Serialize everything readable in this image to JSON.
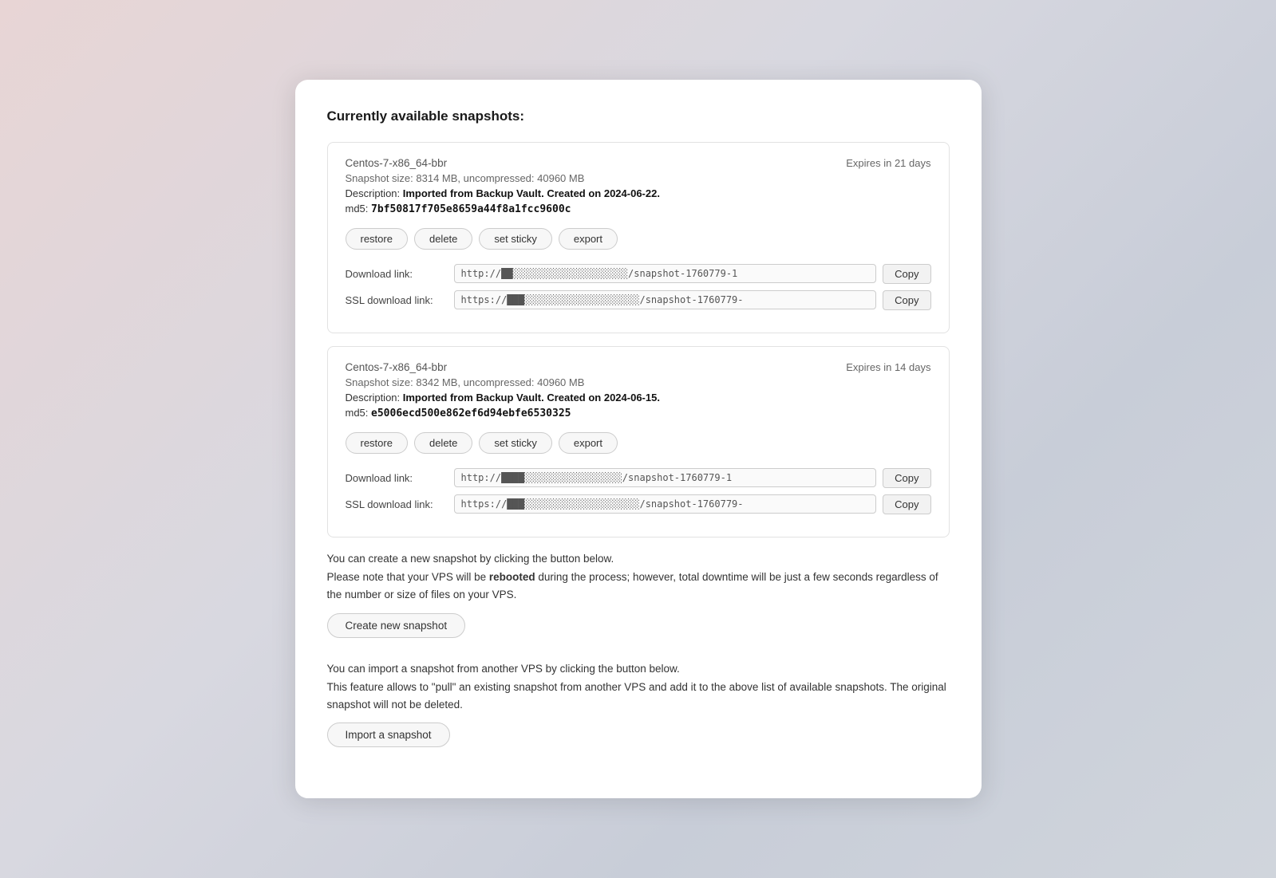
{
  "page": {
    "title": "Currently available snapshots:"
  },
  "snapshots": [
    {
      "id": "snap1",
      "name": "Centos-7-x86_64-bbr",
      "expires": "Expires in 21 days",
      "size": "Snapshot size: 8314 MB, uncompressed: 40960 MB",
      "description_prefix": "Description: ",
      "description_bold": "Imported from Backup Vault. Created on 2024-06-22.",
      "md5_prefix": "md5: ",
      "md5": "7bf50817f705e8659a44f8a1fcc9600c",
      "actions": [
        "restore",
        "delete",
        "set sticky",
        "export"
      ],
      "download_label": "Download link:",
      "download_url": "http://██░░░░░░░░░░░░░░░░░░░░/snapshot-1760779-1",
      "ssl_label": "SSL download link:",
      "ssl_url": "https://███░░░░░░░░░░░░░░░░░░░░/snapshot-1760779-"
    },
    {
      "id": "snap2",
      "name": "Centos-7-x86_64-bbr",
      "expires": "Expires in 14 days",
      "size": "Snapshot size: 8342 MB, uncompressed: 40960 MB",
      "description_prefix": "Description: ",
      "description_bold": "Imported from Backup Vault. Created on 2024-06-15.",
      "md5_prefix": "md5: ",
      "md5": "e5006ecd500e862ef6d94ebfe6530325",
      "actions": [
        "restore",
        "delete",
        "set sticky",
        "export"
      ],
      "download_label": "Download link:",
      "download_url": "http://████░░░░░░░░░░░░░░░░░/snapshot-1760779-1",
      "ssl_label": "SSL download link:",
      "ssl_url": "https://███░░░░░░░░░░░░░░░░░░░░/snapshot-1760779-"
    }
  ],
  "create_section": {
    "info1": "You can create a new snapshot by clicking the button below.",
    "info2_prefix": "Please note that your VPS will be ",
    "info2_bold": "rebooted",
    "info2_suffix": " during the process; however, total downtime will be just a few seconds regardless of the number or size of files on your VPS.",
    "button_label": "Create new snapshot"
  },
  "import_section": {
    "info1": "You can import a snapshot from another VPS by clicking the button below.",
    "info2": "This feature allows to \"pull\" an existing snapshot from another VPS and add it to the above list of available snapshots. The original snapshot will not be deleted.",
    "button_label": "Import a snapshot"
  },
  "buttons": {
    "copy": "Copy",
    "restore": "restore",
    "delete": "delete",
    "set_sticky": "set sticky",
    "export": "export"
  }
}
